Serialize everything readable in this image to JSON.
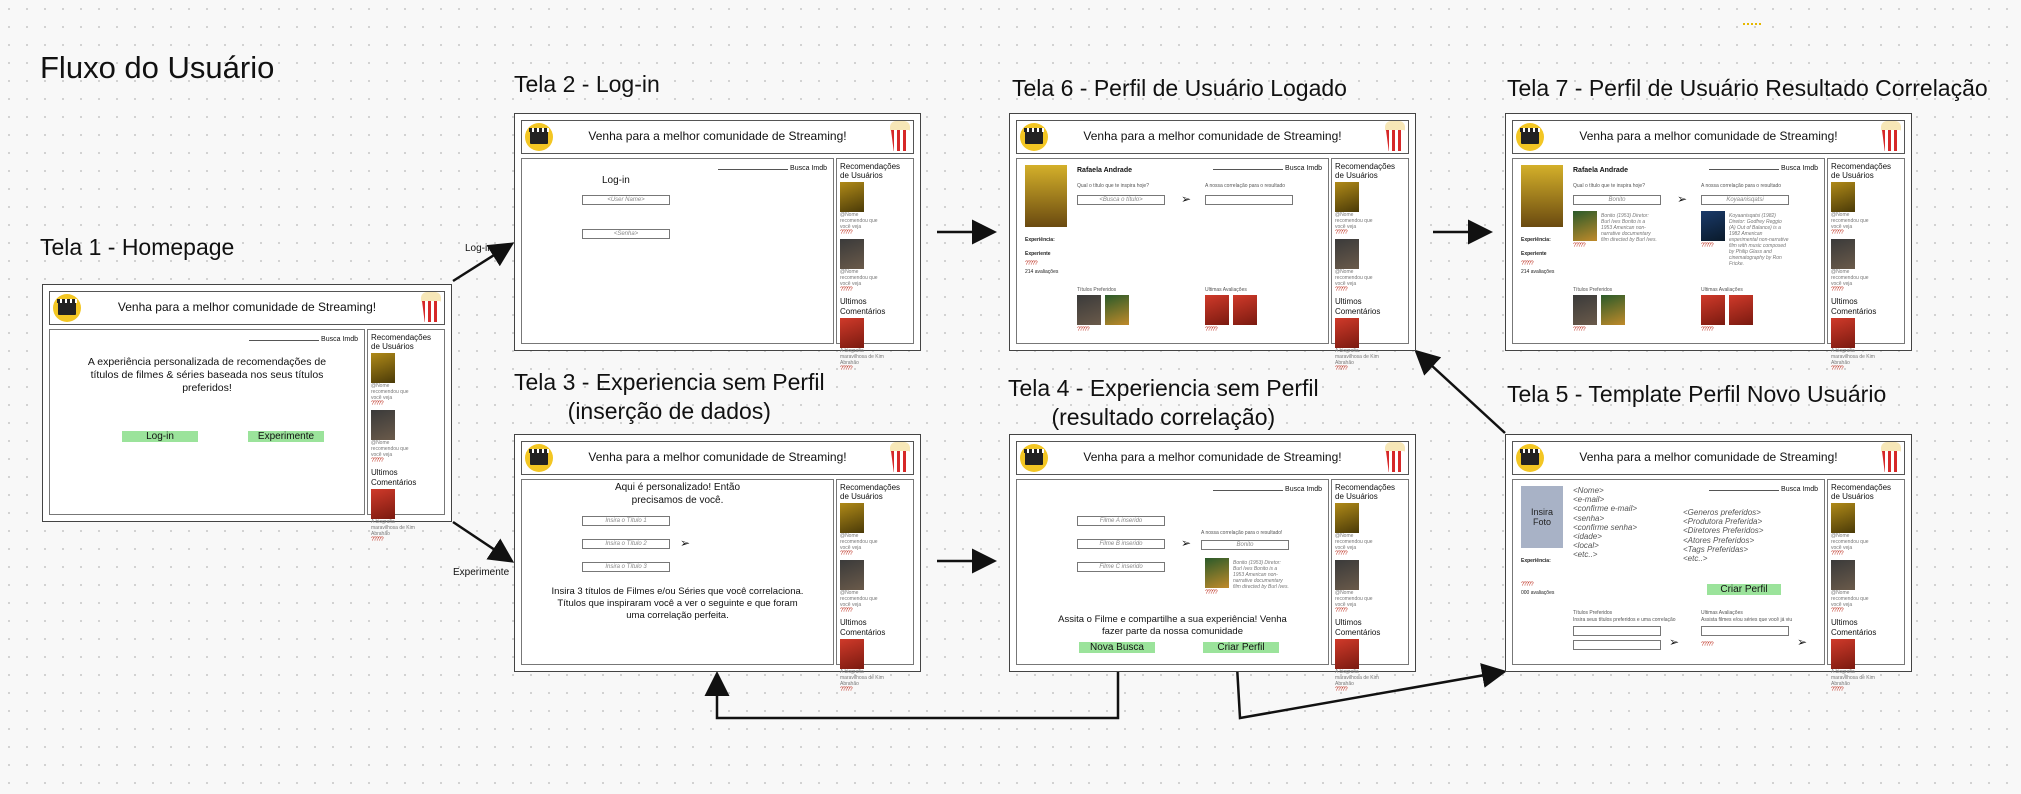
{
  "page_title": "Fluxo do Usuário",
  "header_text": "Venha para a melhor comunidade de Streaming!",
  "search_label": "Busca Imdb",
  "sidebar": {
    "recs_title": "Recomendações de Usuários",
    "comments_title": "Ultimos Comentários",
    "item_text": "@Nome recomendou que você veja",
    "comment_text": "A biografia maravilhosa de Kim Abrahão"
  },
  "stars": "?????",
  "flow_labels": {
    "login": "Log-in",
    "experimente": "Experimente"
  },
  "screens": {
    "s1": {
      "title": "Tela 1 - Homepage",
      "tagline": "A experiência personalizada de recomendações de títulos de filmes & séries baseada nos seus títulos preferidos!",
      "login_button": "Log-in",
      "experiment_button": "Experimente"
    },
    "s2": {
      "title": "Tela 2 - Log-in",
      "login_heading": "Log-in",
      "user_placeholder": "<User Name>",
      "password_placeholder": "<Senha>"
    },
    "s3": {
      "title_l1": "Tela 3 - Experiencia sem Perfil",
      "title_l2": "(inserção de dados)",
      "intro": "Aqui é personalizado! Então precisamos de você.",
      "field1": "Insira o Título 1",
      "field2": "Insira o Título 2",
      "field3": "Insira o Título 3",
      "instructions": "Insira 3 títulos de Filmes e/ou Séries que você correlaciona. Títulos que inspiraram você a ver o seguinte e que foram uma correlação perfeita."
    },
    "s4": {
      "title_l1": "Tela 4 - Experiencia sem Perfil",
      "title_l2": "(resultado correlação)",
      "field1": "Filme A inserido",
      "field2": "Filme B inserido",
      "field3": "Filme C inserido",
      "result_label": "A nossa correlação para o resultado!",
      "result_value": "Bonito",
      "result_desc": "Bonito (1953) Diretor: Burl Ives Bonito is a 1953 American non-narrative documentary film directed by Burl Ives.",
      "cta": "Assita o Filme e compartilhe a sua experiência! Venha fazer parte da nossa comunidade",
      "new_search_button": "Nova Busca",
      "create_profile_button": "Criar Perfil"
    },
    "s5": {
      "title": "Tela 5 - Template Perfil Novo Usuário",
      "photo_label": "Insira Foto",
      "fields_left": [
        "<Nome>",
        "<e-mail>",
        "<confirme e-mail>",
        "<senha>",
        "<confirme senha>",
        "<idade>",
        "<local>",
        "<etc..>"
      ],
      "fields_right": [
        "<Generos preferidos>",
        "<Produtora Preferida>",
        "<Diretores Preferidos>",
        "<Atores Preferidos>",
        "<Tags Preferidas>",
        "<etc..>"
      ],
      "experience_label": "Experiência:",
      "evaluations": "000 avaliações",
      "create_profile_button": "Criar Perfil",
      "fav_titles_label": "Títulos Preferidos",
      "fav_titles_hint": "Insira seus títulos preferidos e uma correlação",
      "last_evals_label": "Ultimas Avaliações",
      "last_evals_hint": "Assista filmes e/ou séries que você já viu"
    },
    "s6": {
      "title": "Tela 6 - Perfil de Usuário Logado",
      "user_name": "Rafaela Andrade",
      "question": "Qual o título que te inspira hoje?",
      "search_placeholder": "<Busca o título>",
      "result_label": "A nossa correlação para o resultado",
      "experience_label": "Experiência:",
      "experience_value": "Experiente",
      "evaluations": "214 avaliações",
      "fav_titles_label": "Títulos Preferidos",
      "last_evals_label": "Ultimas Avaliações"
    },
    "s7": {
      "title": "Tela 7 - Perfil de Usuário Resultado Correlação",
      "user_name": "Rafaela Andrade",
      "question": "Qual o título que te inspira hoje?",
      "search_value": "Bonito",
      "result_label": "A nossa correlação para o resultado",
      "result_value": "Koyaanisqatsi",
      "desc_left": "Bonito (1953) Diretor: Burl Ives Bonito is a 1953 American non-narrative documentary film directed by Burl Ives.",
      "desc_right": "Koyaanisqatsi (1982) Diretor: Godfrey Reggio (A) Out of Balance) is a 1982 American experimental non-narrative film with music composed by Philip Glass and cinematography by Ron Fricke.",
      "experience_label": "Experiência:",
      "experience_value": "Experiente",
      "evaluations": "214 avaliações",
      "fav_titles_label": "Títulos Preferidos",
      "last_evals_label": "Ultimas Avaliações"
    }
  }
}
